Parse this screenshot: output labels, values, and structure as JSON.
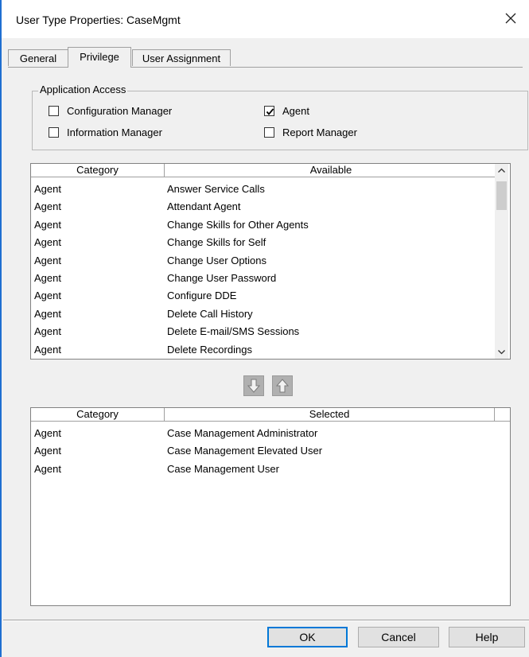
{
  "window": {
    "title": "User Type Properties: CaseMgmt"
  },
  "tabs": [
    {
      "label": "General"
    },
    {
      "label": "Privilege"
    },
    {
      "label": "User Assignment"
    }
  ],
  "application_access": {
    "label": "Application Access",
    "options": [
      {
        "label": "Configuration Manager",
        "checked": false
      },
      {
        "label": "Agent",
        "checked": true
      },
      {
        "label": "Information Manager",
        "checked": false
      },
      {
        "label": "Report Manager",
        "checked": false
      }
    ]
  },
  "available_list": {
    "headers": {
      "category": "Category",
      "value": "Available"
    },
    "rows": [
      {
        "category": "Agent",
        "value": "Answer Service Calls"
      },
      {
        "category": "Agent",
        "value": "Attendant Agent"
      },
      {
        "category": "Agent",
        "value": "Change Skills for Other Agents"
      },
      {
        "category": "Agent",
        "value": "Change Skills for Self"
      },
      {
        "category": "Agent",
        "value": "Change User Options"
      },
      {
        "category": "Agent",
        "value": "Change User Password"
      },
      {
        "category": "Agent",
        "value": "Configure DDE"
      },
      {
        "category": "Agent",
        "value": "Delete Call History"
      },
      {
        "category": "Agent",
        "value": "Delete E-mail/SMS Sessions"
      },
      {
        "category": "Agent",
        "value": "Delete Recordings"
      }
    ]
  },
  "move_buttons": {
    "down_icon": "arrow-down-icon",
    "up_icon": "arrow-up-icon"
  },
  "selected_list": {
    "headers": {
      "category": "Category",
      "value": "Selected"
    },
    "rows": [
      {
        "category": "Agent",
        "value": "Case Management Administrator"
      },
      {
        "category": "Agent",
        "value": "Case Management Elevated User"
      },
      {
        "category": "Agent",
        "value": "Case Management User"
      }
    ]
  },
  "buttons": {
    "ok": "OK",
    "cancel": "Cancel",
    "help": "Help"
  },
  "colors": {
    "window_border": "#1f6fd1",
    "dialog_bg": "#f0f0f0",
    "default_button_border": "#0078d7"
  }
}
